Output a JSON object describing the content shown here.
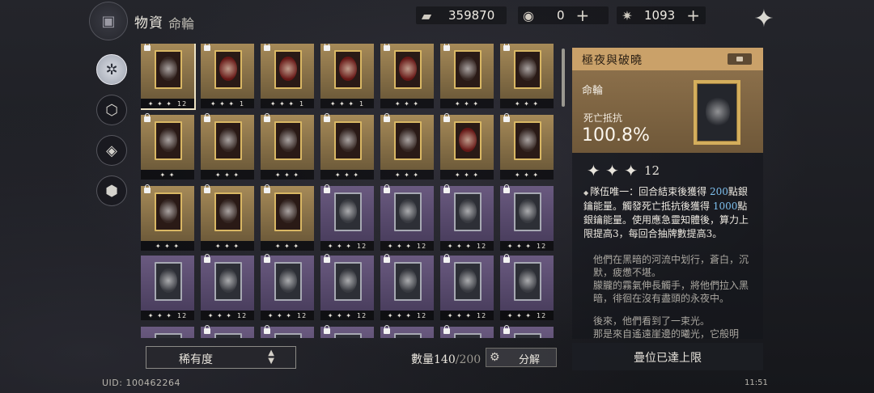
{
  "header": {
    "title": "物資",
    "subtitle": "命輪"
  },
  "resources": [
    {
      "icon": "ticket-icon",
      "value": "359870",
      "has_plus": false
    },
    {
      "icon": "chest-icon",
      "value": "0",
      "has_plus": true
    },
    {
      "icon": "spark-icon",
      "value": "1093",
      "has_plus": true
    }
  ],
  "nav": [
    {
      "icon": "wheel-icon",
      "active": true
    },
    {
      "icon": "hexagon-icon",
      "active": false
    },
    {
      "icon": "compass-icon",
      "active": false
    },
    {
      "icon": "cube-icon",
      "active": false
    }
  ],
  "cards": [
    {
      "rarity": "gold",
      "stars": "✦ ✦ ✦",
      "count": "12",
      "locked": true,
      "selected": true
    },
    {
      "rarity": "gold",
      "stars": "✦ ✦ ✦",
      "count": "1",
      "locked": true,
      "art": "red"
    },
    {
      "rarity": "gold",
      "stars": "✦ ✦ ✦",
      "count": "1",
      "locked": true,
      "art": "red"
    },
    {
      "rarity": "gold",
      "stars": "✦ ✦ ✦",
      "count": "1",
      "locked": true,
      "art": "red"
    },
    {
      "rarity": "gold",
      "stars": "✦ ✦ ✦",
      "count": "",
      "locked": true,
      "art": "red"
    },
    {
      "rarity": "gold",
      "stars": "✦ ✦ ✦",
      "count": "",
      "locked": true
    },
    {
      "rarity": "gold",
      "stars": "✦ ✦ ✦",
      "count": "",
      "locked": true
    },
    {
      "rarity": "gold",
      "stars": "✦ ✦",
      "count": "",
      "locked": true
    },
    {
      "rarity": "gold",
      "stars": "✦ ✦ ✦",
      "count": "",
      "locked": true
    },
    {
      "rarity": "gold",
      "stars": "✦ ✦ ✦",
      "count": "",
      "locked": true
    },
    {
      "rarity": "gold",
      "stars": "✦ ✦ ✦",
      "count": "",
      "locked": true
    },
    {
      "rarity": "gold",
      "stars": "✦ ✦ ✦",
      "count": "",
      "locked": true
    },
    {
      "rarity": "gold",
      "stars": "✦ ✦ ✦",
      "count": "",
      "locked": true,
      "art": "red"
    },
    {
      "rarity": "gold",
      "stars": "✦ ✦ ✦",
      "count": "",
      "locked": true
    },
    {
      "rarity": "gold",
      "stars": "✦ ✦ ✦",
      "count": "",
      "locked": true
    },
    {
      "rarity": "gold",
      "stars": "✦ ✦ ✦",
      "count": "",
      "locked": true
    },
    {
      "rarity": "gold",
      "stars": "✦ ✦ ✦",
      "count": "",
      "locked": true
    },
    {
      "rarity": "purple",
      "stars": "✦ ✦ ✦",
      "count": "12",
      "locked": true
    },
    {
      "rarity": "purple",
      "stars": "✦ ✦ ✦",
      "count": "12",
      "locked": true
    },
    {
      "rarity": "purple",
      "stars": "✦ ✦ ✦",
      "count": "12",
      "locked": true
    },
    {
      "rarity": "purple",
      "stars": "✦ ✦ ✦",
      "count": "12",
      "locked": true
    },
    {
      "rarity": "purple",
      "stars": "✦ ✦ ✦",
      "count": "12",
      "locked": false
    },
    {
      "rarity": "purple",
      "stars": "✦ ✦ ✦",
      "count": "12",
      "locked": true
    },
    {
      "rarity": "purple",
      "stars": "✦ ✦ ✦",
      "count": "12",
      "locked": true
    },
    {
      "rarity": "purple",
      "stars": "✦ ✦ ✦",
      "count": "12",
      "locked": true
    },
    {
      "rarity": "purple",
      "stars": "✦ ✦ ✦",
      "count": "12",
      "locked": true
    },
    {
      "rarity": "purple",
      "stars": "✦ ✦ ✦",
      "count": "12",
      "locked": true
    },
    {
      "rarity": "purple",
      "stars": "✦ ✦ ✦",
      "count": "12",
      "locked": true
    },
    {
      "rarity": "purple",
      "stars": "",
      "count": "",
      "locked": false
    },
    {
      "rarity": "purple",
      "stars": "",
      "count": "",
      "locked": true
    },
    {
      "rarity": "purple",
      "stars": "",
      "count": "",
      "locked": true
    },
    {
      "rarity": "purple",
      "stars": "",
      "count": "",
      "locked": true
    },
    {
      "rarity": "purple",
      "stars": "",
      "count": "",
      "locked": true
    },
    {
      "rarity": "purple",
      "stars": "",
      "count": "",
      "locked": true
    },
    {
      "rarity": "purple",
      "stars": "",
      "count": "",
      "locked": true
    }
  ],
  "detail": {
    "name": "極夜與破曉",
    "type": "命輪",
    "stat_label": "死亡抵抗",
    "stat_value": "100.8%",
    "stars": "✦ ✦ ✦",
    "star_count": "12",
    "effect_pre": "隊伍唯一：回合結束後獲得",
    "effect_num1": "200",
    "effect_mid": "點銀鑰能量。觸發死亡抵抗後獲得",
    "effect_num2": "1000",
    "effect_post": "點銀鑰能量。使用應急靈知體後，算力上限提高3，每回合抽牌數提高3。",
    "flavor": [
      "他們在黑暗的河流中划行，蒼白，沉默，疲憊不堪。",
      "朦朧的霧氣伸長觸手，將他們拉入黑暗，徘徊在沒有盡頭的永夜中。",
      "",
      "後來，他們看到了一束光。",
      "那是來自遙遠崖邊的曦光，它般明"
    ]
  },
  "footer": {
    "sort_label": "稀有度",
    "qty_label": "數量140",
    "qty_max": "/200",
    "decompose_label": "分解",
    "max_label": "疊位已達上限",
    "uid": "UID: 100462264",
    "clock": "11:51"
  },
  "colors": {
    "gold_header": "#caa169",
    "highlight_blue": "#7ec0ee"
  }
}
